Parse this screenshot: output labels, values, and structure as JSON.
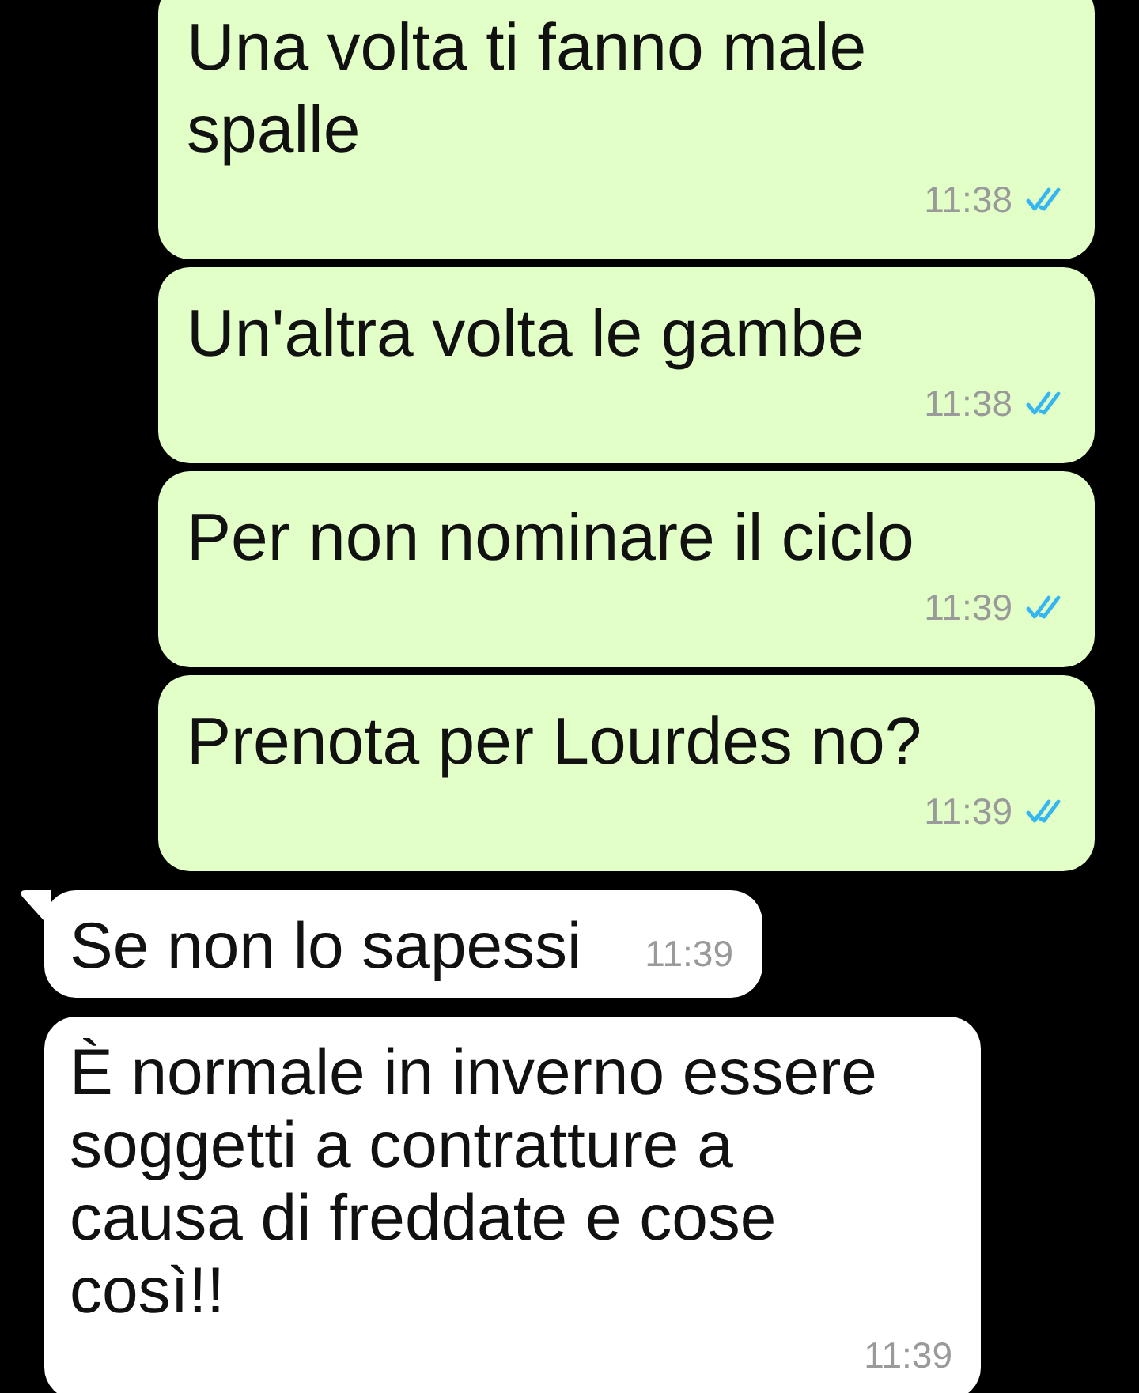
{
  "messages": [
    {
      "kind": "outgoing",
      "text": "Una volta ti fanno male spalle",
      "time": "11:38",
      "read": true
    },
    {
      "kind": "outgoing",
      "text": "Un'altra volta le gambe",
      "time": "11:38",
      "read": true
    },
    {
      "kind": "outgoing",
      "text": "Per non nominare il ciclo",
      "time": "11:39",
      "read": true
    },
    {
      "kind": "outgoing",
      "text": "Prenota per Lourdes no?",
      "time": "11:39",
      "read": true
    },
    {
      "kind": "incoming",
      "text": "Se non lo sapessi",
      "time": "11:39",
      "tail": true
    },
    {
      "kind": "incoming",
      "text": "È normale in inverno essere soggetti a contratture a causa di freddate e cose così!!",
      "time": "11:39",
      "tail": false
    }
  ]
}
